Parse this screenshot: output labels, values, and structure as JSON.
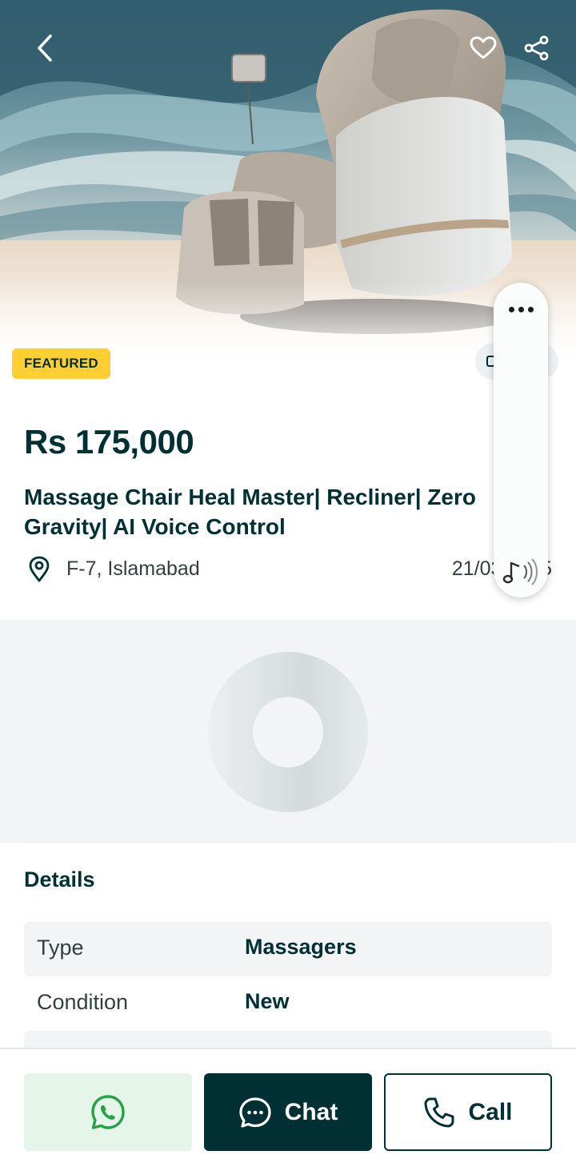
{
  "listing": {
    "badge": "FEATURED",
    "price": "Rs 175,000",
    "title": "Massage Chair Heal Master| Recliner| Zero Gravity| AI Voice Control",
    "location": "F-7, Islamabad",
    "date": "21/03/2025"
  },
  "details": {
    "heading": "Details",
    "rows": [
      {
        "key": "Type",
        "value": "Massagers"
      },
      {
        "key": "Condition",
        "value": "New"
      }
    ]
  },
  "actions": {
    "chat_label": "Chat",
    "call_label": "Call"
  },
  "icons": {
    "back": "chevron-left-icon",
    "favorite": "heart-icon",
    "share": "share-icon",
    "location": "map-pin-icon",
    "whatsapp": "whatsapp-icon",
    "chat": "chat-bubble-icon",
    "call": "phone-icon",
    "more": "more-dots-icon",
    "audio": "audio-note-icon"
  },
  "colors": {
    "brand_dark": "#002f34",
    "featured_yellow": "#ffce32",
    "whatsapp_green": "#25a244",
    "whatsapp_bg": "#e6f5e9"
  }
}
